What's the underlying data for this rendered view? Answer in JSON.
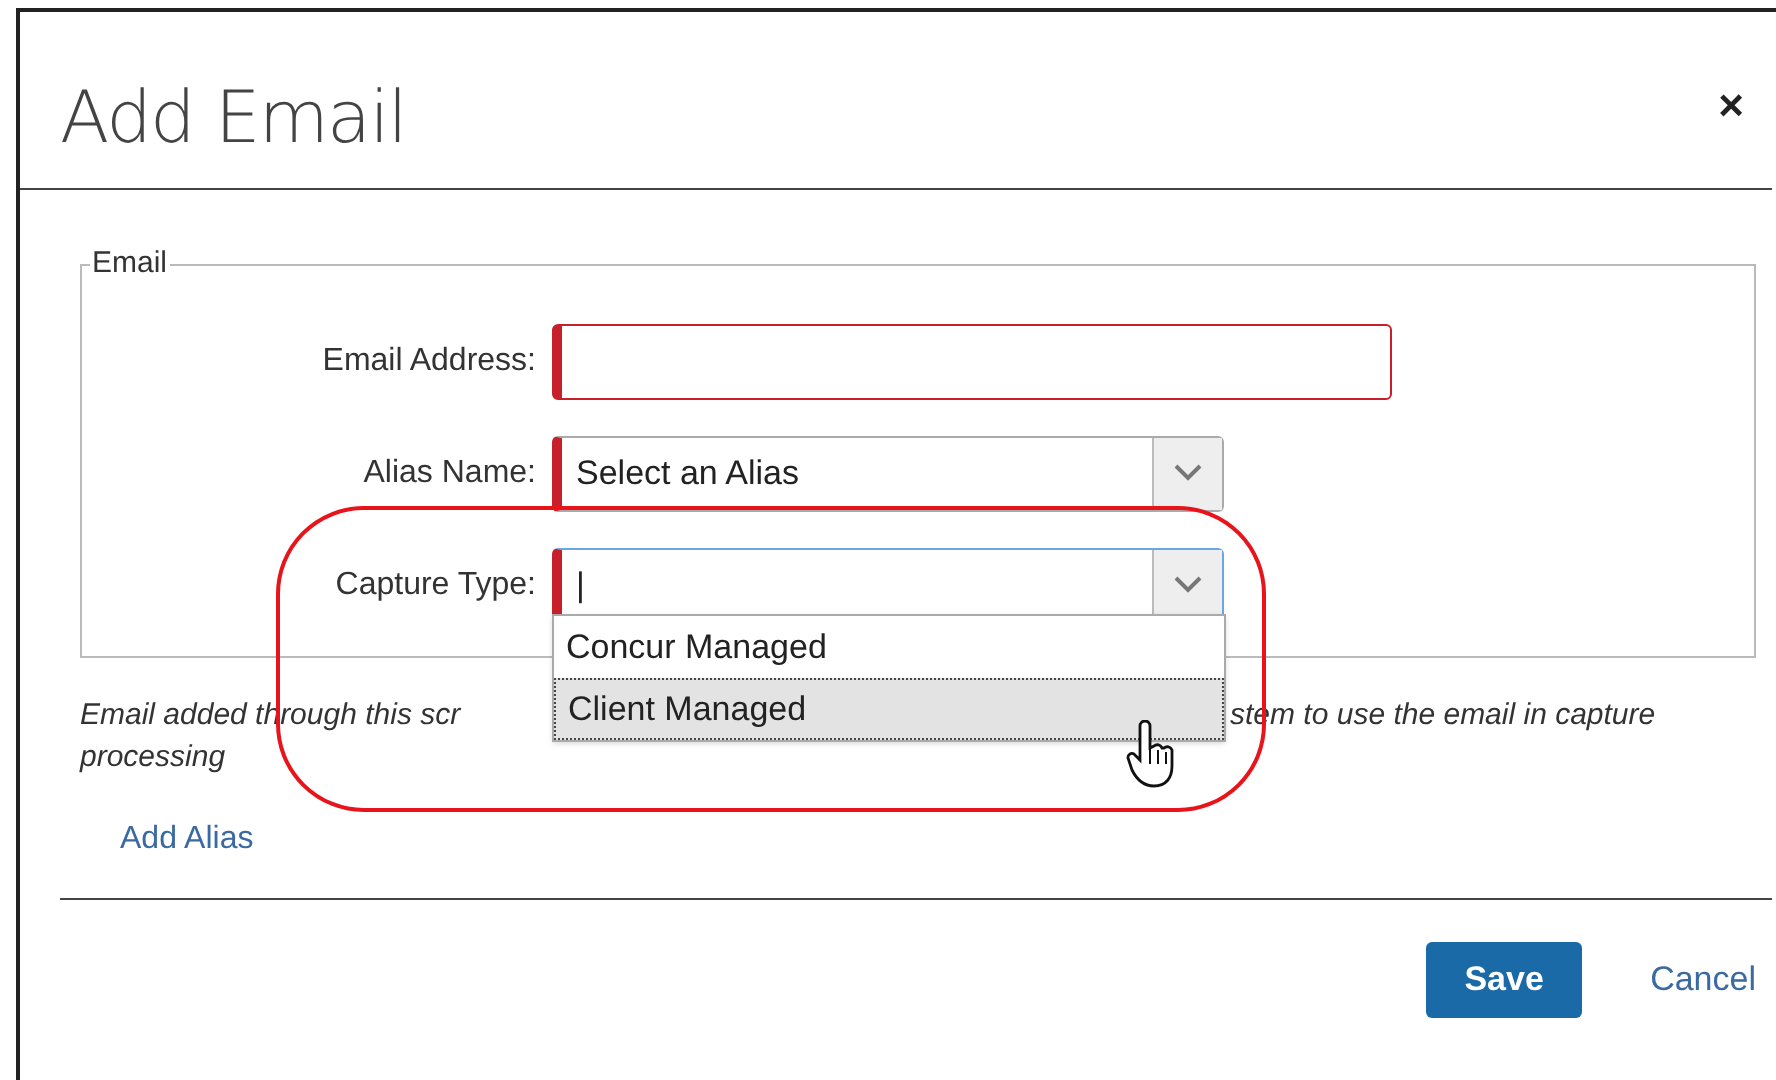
{
  "dialog": {
    "title": "Add Email",
    "close": "×"
  },
  "fieldset": {
    "legend": "Email",
    "fields": [
      {
        "kind": "text",
        "label": "Email Address:",
        "required": true,
        "focused": false
      },
      {
        "kind": "select",
        "label": "Alias Name:",
        "required": true,
        "focused": false,
        "value": "Select an Alias"
      },
      {
        "kind": "select",
        "label": "Capture Type:",
        "required": true,
        "focused": true,
        "value": "|"
      }
    ]
  },
  "dropdown": {
    "options": [
      {
        "label": "Concur Managed",
        "selected": false
      },
      {
        "label": "Client Managed",
        "selected": true
      }
    ]
  },
  "note": {
    "visible_start": "Email added through this scr",
    "visible_end": "stem to use the email in capture",
    "line_2": "processing"
  },
  "add_alias_link": "Add Alias",
  "buttons": [
    {
      "kind": "primary",
      "label": "Save"
    },
    {
      "kind": "link",
      "label": "Cancel"
    }
  ]
}
